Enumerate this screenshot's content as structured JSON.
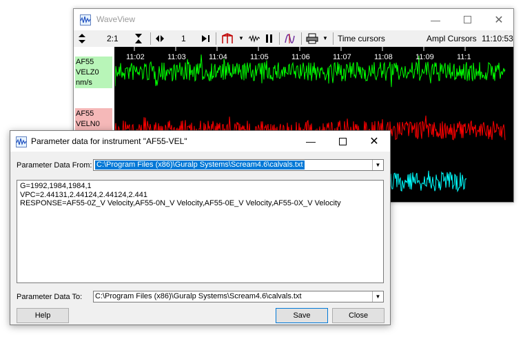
{
  "waveview": {
    "title": "WaveView",
    "toolbar": {
      "zoom_ratio": "2:1",
      "page_number": "1",
      "time_cursors": "Time cursors",
      "ampl_cursors": "Ampl Cursors",
      "clock": "11:10:53"
    },
    "time_ticks": [
      "11:02",
      "11:03",
      "11:04",
      "11:05",
      "11:06",
      "11:07",
      "11:08",
      "11:09",
      "11:1"
    ],
    "channels": [
      {
        "station": "AF55",
        "component": "VELZ0",
        "unit": "nm/s",
        "trace_color": "#00ff00"
      },
      {
        "station": "AF55",
        "component": "VELN0",
        "trace_color": "#ff0000"
      },
      {
        "trace_color": "#00ffff"
      }
    ]
  },
  "dialog": {
    "title": "Parameter data for instrument \"AF55-VEL\"",
    "from_label": "Parameter Data From:",
    "from_value": "C:\\Program Files (x86)\\Guralp Systems\\Scream4.6\\calvals.txt",
    "params": [
      "G=1992,1984,1984,1",
      "VPC=2.44131,2.44124,2.44124,2.441",
      "RESPONSE=AF55-0Z_V Velocity,AF55-0N_V Velocity,AF55-0E_V Velocity,AF55-0X_V Velocity"
    ],
    "to_label": "Parameter Data To:",
    "to_value": "C:\\Program Files (x86)\\Guralp Systems\\Scream4.6\\calvals.txt",
    "buttons": {
      "help": "Help",
      "save": "Save",
      "close": "Close"
    }
  }
}
